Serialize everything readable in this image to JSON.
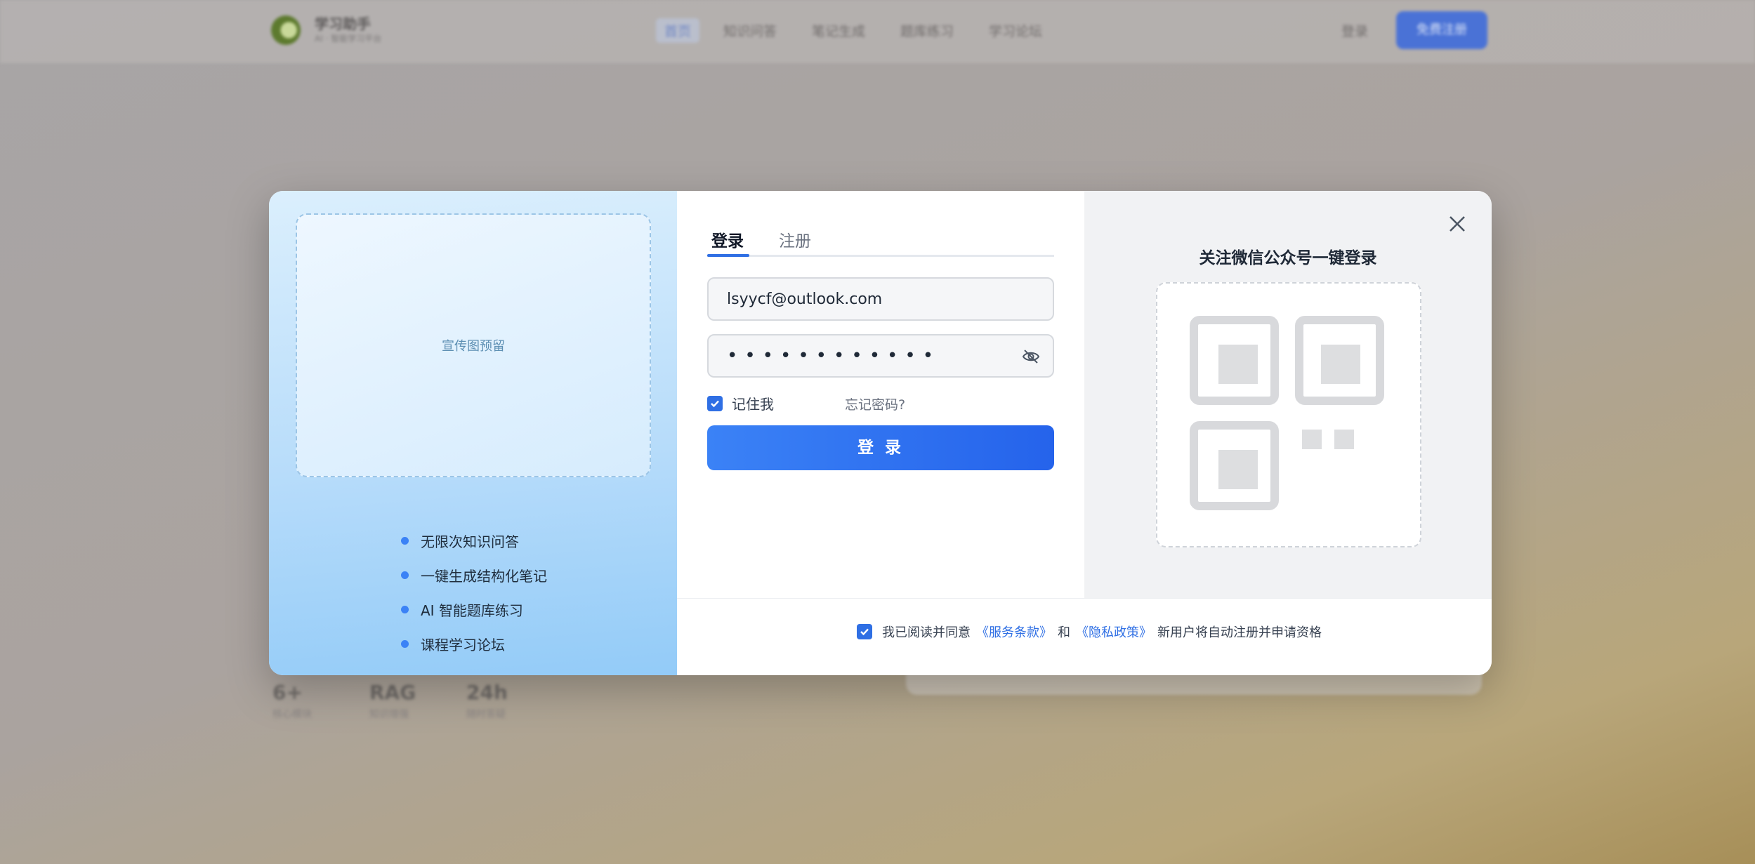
{
  "background": {
    "brand": "学习助手",
    "brand_sub": "AI · 智能学习平台",
    "nav": [
      "首页",
      "知识问答",
      "笔记生成",
      "题库练习",
      "学习论坛"
    ],
    "login_link": "登录",
    "signup_button": "免费注册",
    "stats": [
      {
        "value": "6+",
        "label": "核心模块"
      },
      {
        "value": "RAG",
        "label": "知识增强"
      },
      {
        "value": "24h",
        "label": "随时答疑"
      }
    ]
  },
  "modal": {
    "promo_placeholder": "宣传图预留",
    "features": [
      "无限次知识问答",
      "一键生成结构化笔记",
      "AI 智能题库练习",
      "课程学习论坛"
    ],
    "tabs": [
      "登录",
      "注册"
    ],
    "email_value": "lsyycf@outlook.com",
    "password_masked": "••••••••••••",
    "remember_label": "记住我",
    "remember_checked": true,
    "forgot_label": "忘记密码?",
    "login_button": "登 录",
    "qr_title": "关注微信公众号一键登录",
    "agree": {
      "prefix": "我已阅读并同意",
      "terms": "《服务条款》",
      "and": "和",
      "privacy": "《隐私政策》",
      "suffix": "新用户将自动注册并申请资格"
    },
    "accent_color": "#2f6fe4"
  }
}
